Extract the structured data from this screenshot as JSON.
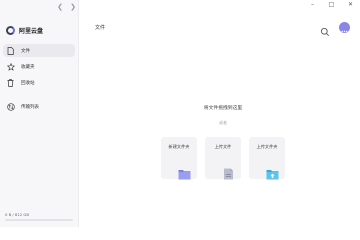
{
  "sidebar": {
    "brand": "阿里云盘",
    "items": [
      {
        "label": "文件",
        "icon": "file-icon",
        "active": true
      },
      {
        "label": "收藏夹",
        "icon": "star-icon",
        "active": false
      },
      {
        "label": "回收站",
        "icon": "trash-icon",
        "active": false
      },
      {
        "label": "传输列表",
        "icon": "transfer-icon",
        "active": false
      }
    ],
    "storage_text": "0 B / 812 GB",
    "storage_fraction": 0.0
  },
  "header": {
    "title": "文件"
  },
  "main": {
    "drop_hint": "将文件拖拽到这里",
    "drop_sub": "或者",
    "actions": [
      {
        "label": "新建文件夹",
        "icon": "new-folder-icon"
      },
      {
        "label": "上传文件",
        "icon": "upload-file-icon"
      },
      {
        "label": "上传文件夹",
        "icon": "upload-folder-icon"
      }
    ]
  },
  "window_controls": [
    "minimize-icon",
    "maximize-icon",
    "close-icon"
  ],
  "colors": {
    "accent": "#6c6cf0",
    "sidebar_bg": "#f7f7f9",
    "active_item": "#e9e9ee"
  }
}
